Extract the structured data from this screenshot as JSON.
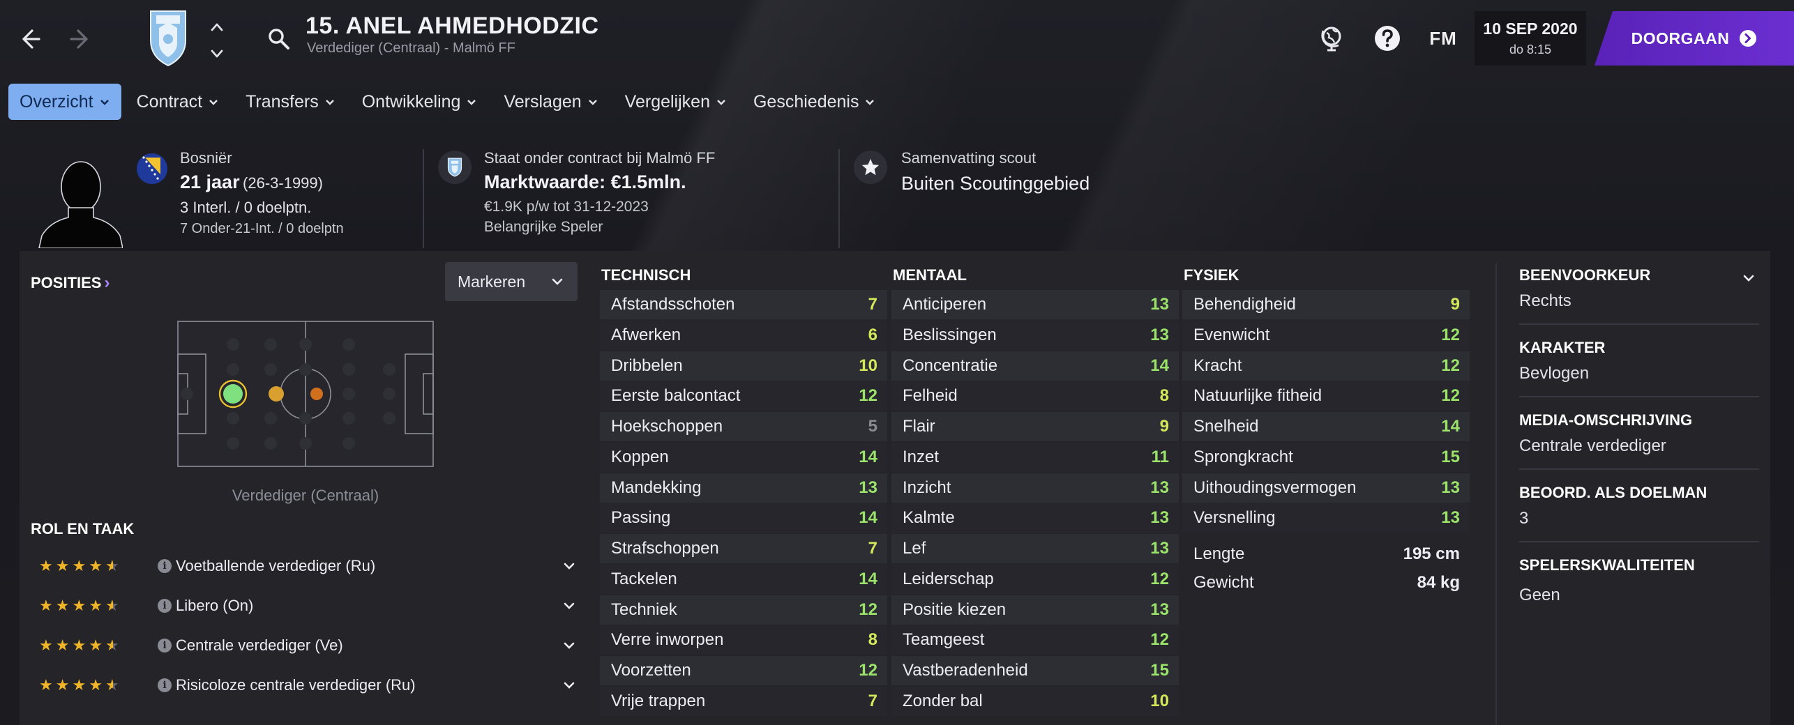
{
  "header": {
    "player_title": "15. ANEL AHMEDHODZIC",
    "player_subtitle": "Verdediger (Centraal) - Malmö FF",
    "fm_logo": "FM",
    "date": "10 SEP 2020",
    "time": "do 8:15",
    "continue_label": "DOORGAAN",
    "icons": [
      "back-arrow-icon",
      "forward-arrow-icon",
      "club-crest-icon",
      "chevron-up-icon",
      "chevron-down-icon",
      "search-icon",
      "globe-icon",
      "help-icon",
      "continue-arrow-icon"
    ]
  },
  "tabs": [
    {
      "label": "Overzicht",
      "active": true
    },
    {
      "label": "Contract",
      "active": false
    },
    {
      "label": "Transfers",
      "active": false
    },
    {
      "label": "Ontwikkeling",
      "active": false
    },
    {
      "label": "Verslagen",
      "active": false
    },
    {
      "label": "Vergelijken",
      "active": false
    },
    {
      "label": "Geschiedenis",
      "active": false
    }
  ],
  "profile": {
    "nationality": "Bosniër",
    "age": "21 jaar",
    "birthdate": "(26-3-1999)",
    "caps": "3 Interl. / 0 doelptn.",
    "u21_caps": "7 Onder-21-Int. / 0 doelptn",
    "contract_status": "Staat onder contract bij Malmö FF",
    "market_value": "Marktwaarde: €1.5mln.",
    "wage": "€1.9K p/w tot 31-12-2023",
    "squad_status": "Belangrijke Speler",
    "scout_label": "Samenvatting scout",
    "scout_value": "Buiten Scoutinggebied"
  },
  "positions": {
    "title": "POSITIES",
    "chevron": "›",
    "mark_label": "Markeren",
    "position_label": "Verdediger (Centraal)"
  },
  "roles": {
    "title": "ROL EN TAAK",
    "info_glyph": "i",
    "items": [
      {
        "name": "Voetballende verdediger (Ru)",
        "stars": 4.5
      },
      {
        "name": "Libero (On)",
        "stars": 4.5
      },
      {
        "name": "Centrale verdediger (Ve)",
        "stars": 4.5
      },
      {
        "name": "Risicoloze centrale verdediger (Ru)",
        "stars": 4.5
      }
    ]
  },
  "attributes": {
    "technical": {
      "title": "TECHNISCH",
      "items": [
        {
          "name": "Afstandsschoten",
          "value": "7"
        },
        {
          "name": "Afwerken",
          "value": "6"
        },
        {
          "name": "Dribbelen",
          "value": "10"
        },
        {
          "name": "Eerste balcontact",
          "value": "12"
        },
        {
          "name": "Hoekschoppen",
          "value": "5"
        },
        {
          "name": "Koppen",
          "value": "14"
        },
        {
          "name": "Mandekking",
          "value": "13"
        },
        {
          "name": "Passing",
          "value": "14"
        },
        {
          "name": "Strafschoppen",
          "value": "7"
        },
        {
          "name": "Tackelen",
          "value": "14"
        },
        {
          "name": "Techniek",
          "value": "12"
        },
        {
          "name": "Verre inworpen",
          "value": "8"
        },
        {
          "name": "Voorzetten",
          "value": "12"
        },
        {
          "name": "Vrije trappen",
          "value": "7"
        }
      ]
    },
    "mental": {
      "title": "MENTAAL",
      "items": [
        {
          "name": "Anticiperen",
          "value": "13"
        },
        {
          "name": "Beslissingen",
          "value": "13"
        },
        {
          "name": "Concentratie",
          "value": "14"
        },
        {
          "name": "Felheid",
          "value": "8"
        },
        {
          "name": "Flair",
          "value": "9"
        },
        {
          "name": "Inzet",
          "value": "11"
        },
        {
          "name": "Inzicht",
          "value": "13"
        },
        {
          "name": "Kalmte",
          "value": "13"
        },
        {
          "name": "Lef",
          "value": "13"
        },
        {
          "name": "Leiderschap",
          "value": "12"
        },
        {
          "name": "Positie kiezen",
          "value": "13"
        },
        {
          "name": "Teamgeest",
          "value": "12"
        },
        {
          "name": "Vastberadenheid",
          "value": "15"
        },
        {
          "name": "Zonder bal",
          "value": "10"
        }
      ]
    },
    "physical": {
      "title": "FYSIEK",
      "items": [
        {
          "name": "Behendigheid",
          "value": "9"
        },
        {
          "name": "Evenwicht",
          "value": "12"
        },
        {
          "name": "Kracht",
          "value": "12"
        },
        {
          "name": "Natuurlijke fitheid",
          "value": "12"
        },
        {
          "name": "Snelheid",
          "value": "14"
        },
        {
          "name": "Sprongkracht",
          "value": "15"
        },
        {
          "name": "Uithoudingsvermogen",
          "value": "13"
        },
        {
          "name": "Versnelling",
          "value": "13"
        }
      ],
      "height_label": "Lengte",
      "height_value": "195 cm",
      "weight_label": "Gewicht",
      "weight_value": "84 kg"
    }
  },
  "details": [
    {
      "label": "BEENVOORKEUR",
      "value": "Rechts"
    },
    {
      "label": "KARAKTER",
      "value": "Bevlogen"
    },
    {
      "label": "MEDIA-OMSCHRIJVING",
      "value": "Centrale verdediger"
    },
    {
      "label": "BEOORD. ALS DOELMAN",
      "value": "3"
    },
    {
      "label": "SPELERSKWALITEITEN",
      "value": "Geen"
    }
  ],
  "colors": {
    "accent_purple": "#6b2fd1",
    "tab_active": "#7eaef0",
    "attr_high": "#9be36a",
    "attr_mid": "#d4e85a",
    "attr_low": "#8b8b93",
    "star": "#f0b429",
    "natural_position": "#7ee07e",
    "accomplished_position": "#d9a030",
    "unconvincing_position": "#d0701e"
  }
}
